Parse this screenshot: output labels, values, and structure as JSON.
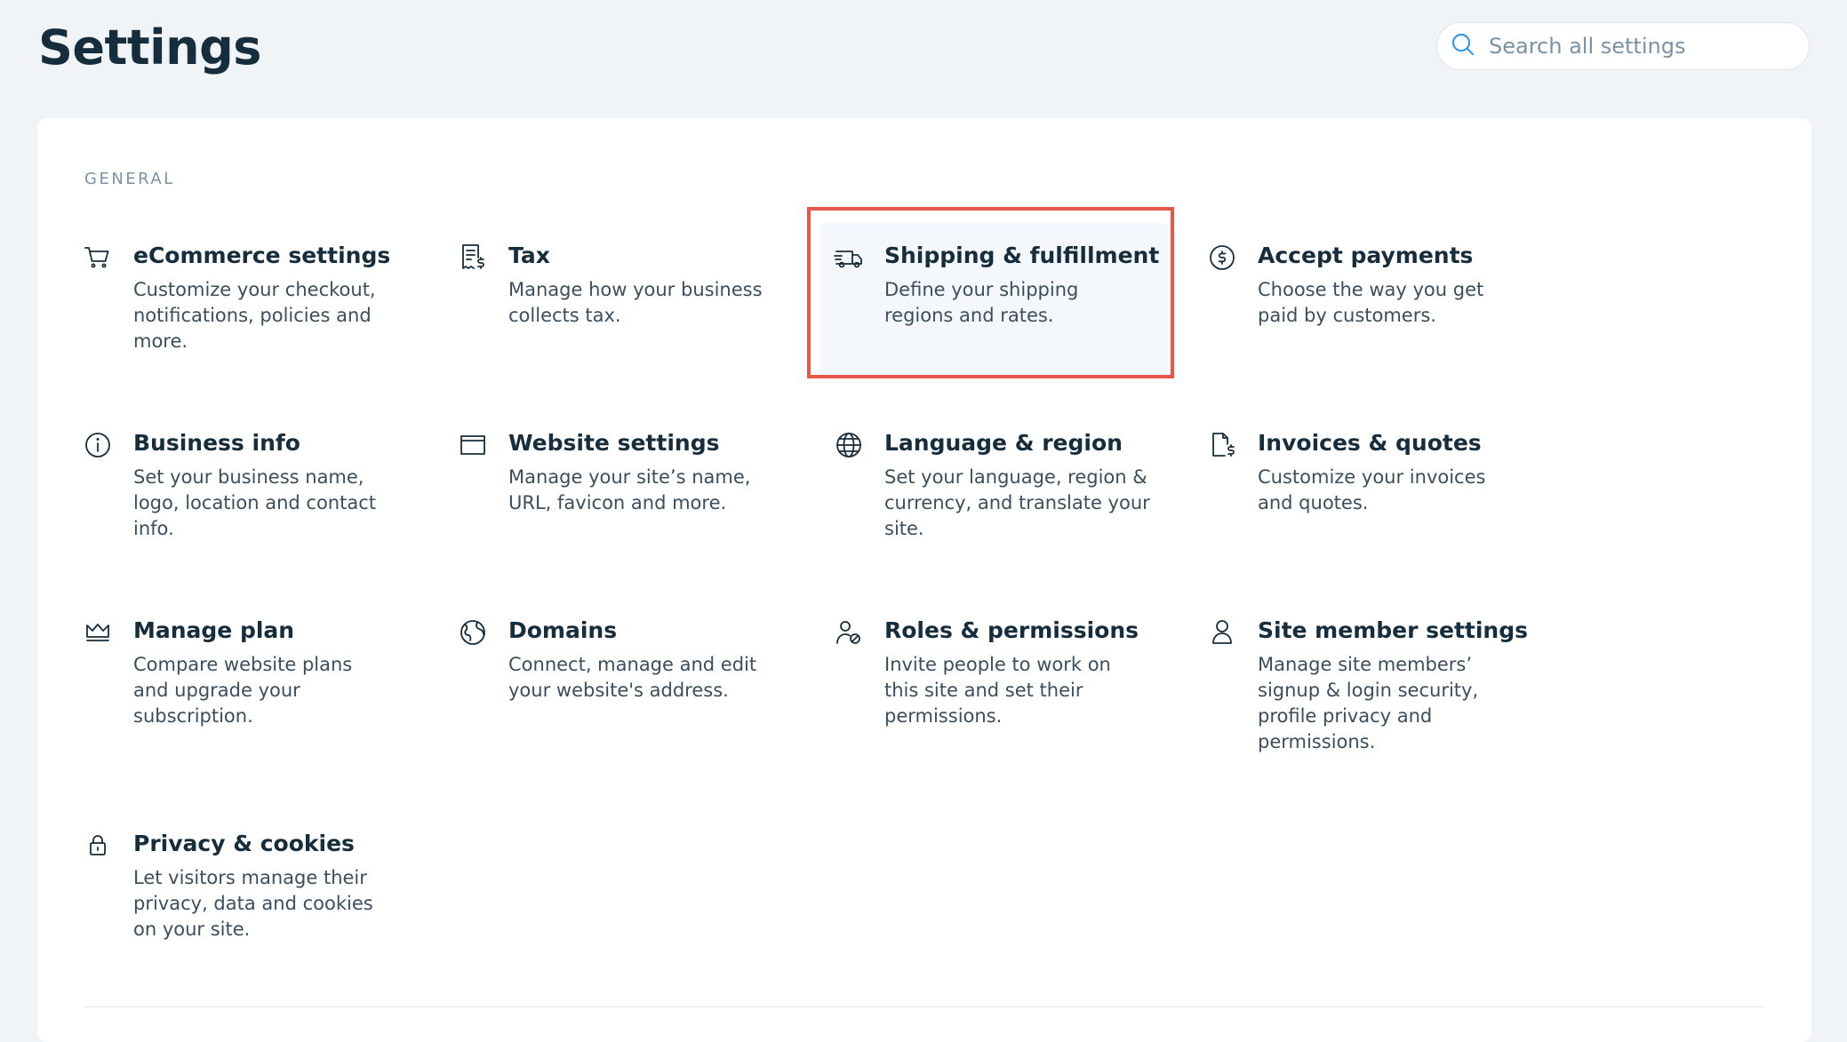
{
  "page": {
    "title": "Settings"
  },
  "search": {
    "placeholder": "Search all settings",
    "icon": "search-icon"
  },
  "colors": {
    "background": "#f0f4f7",
    "card": "#ffffff",
    "text": "#162d3d",
    "muted": "#7a92a5",
    "highlight_border": "#e8564a",
    "highlight_fill": "#f4f8fd"
  },
  "section": {
    "label": "GENERAL"
  },
  "tiles": [
    {
      "id": "ecommerce",
      "icon": "cart-icon",
      "title": "eCommerce settings",
      "desc": "Customize your checkout, notifications, policies and more."
    },
    {
      "id": "tax",
      "icon": "tax-receipt-icon",
      "title": "Tax",
      "desc": "Manage how your business collects tax."
    },
    {
      "id": "shipping",
      "icon": "delivery-truck-icon",
      "title": "Shipping & fulfillment",
      "desc": "Define your shipping regions and rates.",
      "highlighted": true
    },
    {
      "id": "payments",
      "icon": "dollar-coin-icon",
      "title": "Accept payments",
      "desc": "Choose the way you get paid by customers."
    },
    {
      "id": "business-info",
      "icon": "info-icon",
      "title": "Business info",
      "desc": "Set your business name, logo, location and contact info."
    },
    {
      "id": "website",
      "icon": "browser-window-icon",
      "title": "Website settings",
      "desc": "Manage your site’s name, URL, favicon and more."
    },
    {
      "id": "language",
      "icon": "globe-icon",
      "title": "Language & region",
      "desc": "Set your language, region & currency, and translate your site."
    },
    {
      "id": "invoices",
      "icon": "invoice-icon",
      "title": "Invoices & quotes",
      "desc": "Customize your invoices and quotes."
    },
    {
      "id": "plan",
      "icon": "crown-icon",
      "title": "Manage plan",
      "desc": "Compare website plans and upgrade your subscription."
    },
    {
      "id": "domains",
      "icon": "domain-globe-icon",
      "title": "Domains",
      "desc": "Connect, manage and edit your website's address."
    },
    {
      "id": "roles",
      "icon": "user-permissions-icon",
      "title": "Roles & permissions",
      "desc": "Invite people to work on this site and set their permissions."
    },
    {
      "id": "members",
      "icon": "user-icon",
      "title": "Site member settings",
      "desc": "Manage site members’ signup & login security, profile privacy and permissions."
    },
    {
      "id": "privacy",
      "icon": "lock-icon",
      "title": "Privacy & cookies",
      "desc": "Let visitors manage their privacy, data and cookies on your site."
    }
  ]
}
